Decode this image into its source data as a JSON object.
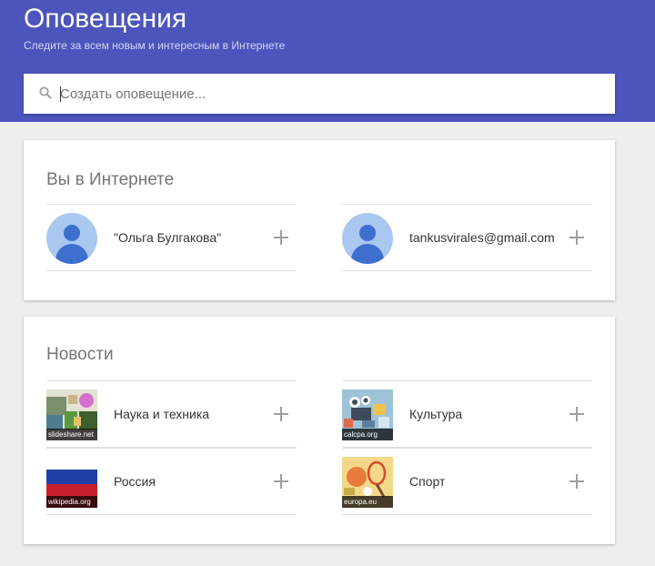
{
  "header": {
    "title": "Оповещения",
    "subtitle": "Следите за всем новым и интересным в Интернете"
  },
  "search": {
    "placeholder": "Создать оповещение..."
  },
  "you_online": {
    "title": "Вы в Интернете",
    "items": [
      {
        "label": "\"Ольга Булгакова\""
      },
      {
        "label": "tankusvirales@gmail.com"
      }
    ]
  },
  "news": {
    "title": "Новости",
    "items": [
      {
        "label": "Наука и техника",
        "source": "slideshare.net"
      },
      {
        "label": "Культура",
        "source": "calcpa.org"
      },
      {
        "label": "Россия",
        "source": "wikipedia.org"
      },
      {
        "label": "Спорт",
        "source": "europa.eu"
      }
    ]
  },
  "colors": {
    "header_bg": "#4b55bb",
    "avatar_bg": "#a9c7ef",
    "avatar_fg": "#3e6fcf"
  }
}
